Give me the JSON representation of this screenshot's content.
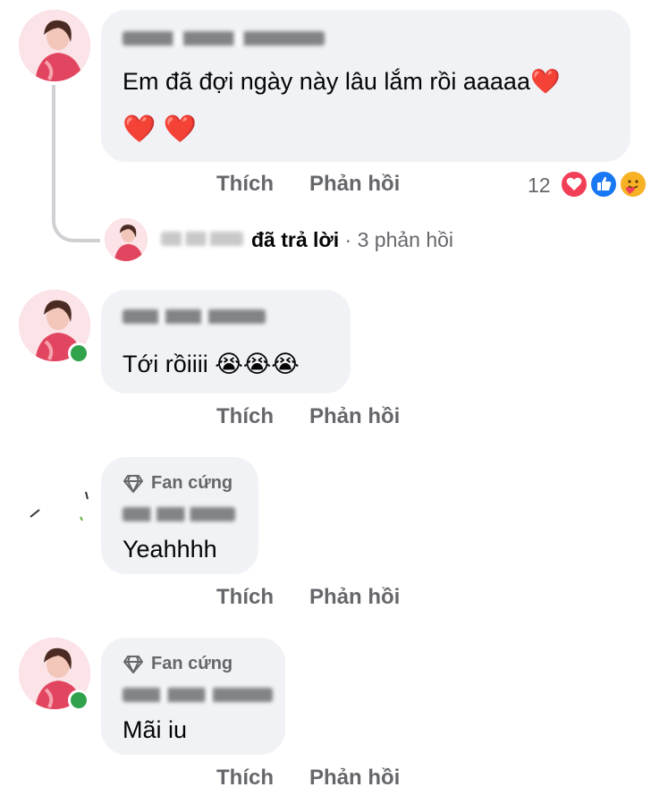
{
  "comments": [
    {
      "text": "Em đã đợi ngày này lâu lắm rồi aaaaa❤️",
      "text_line2": "❤️ ❤️",
      "like_label": "Thích",
      "reply_label": "Phản hồi",
      "reaction_count": "12",
      "reply_summary": {
        "action": "đã trả lời",
        "separator": " · ",
        "count_text": "3 phản hồi"
      }
    },
    {
      "text": "Tới rồiiii 😭😭😭",
      "like_label": "Thích",
      "reply_label": "Phản hồi"
    },
    {
      "badge": "Fan cứng",
      "text": "Yeahhhh",
      "like_label": "Thích",
      "reply_label": "Phản hồi"
    },
    {
      "badge": "Fan cứng",
      "text": "Mãi iu",
      "like_label": "Thích",
      "reply_label": "Phản hồi"
    }
  ],
  "colors": {
    "bubble": "#f0f2f5",
    "action_text": "#65676b",
    "online": "#31a24c",
    "love": "#f33e58",
    "like": "#1877f2",
    "care": "#f7b125"
  },
  "icons": [
    "diamond-icon",
    "love-reaction-icon",
    "like-reaction-icon",
    "care-reaction-icon"
  ]
}
